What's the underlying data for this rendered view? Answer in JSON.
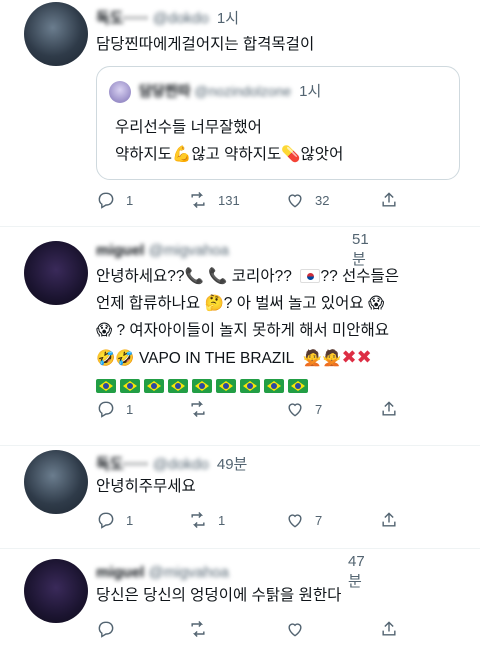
{
  "tweets": [
    {
      "display_name": "독도·····",
      "handle": "@dokdo",
      "time": "1시",
      "text": "담당찐따에게걸어지는 합격목걸이",
      "quote": {
        "display_name": "담당찐따",
        "handle": "@nozindolzone",
        "time": "1시",
        "line1": "우리선수들 너무잘했어",
        "line2_a": "약하지도",
        "line2_b": "않고 약하지도",
        "line2_c": "않앗어",
        "emoji_muscle": "💪",
        "emoji_pill": "💊"
      },
      "replies": "1",
      "retweets": "131",
      "likes": "32"
    },
    {
      "display_name": "miguel",
      "handle": "@migvahoa",
      "time": "51분",
      "lines": [
        "안녕하세요??",
        "코리아??",
        "?? 선수들은",
        "언제 합류하나요",
        "? 아 벌써 놀고 있어요",
        "? 여자아이들이 놀지 못하게 해서 미안해요",
        "VAPO IN THE BRAZIL"
      ],
      "replies": "1",
      "retweets": "",
      "likes": "7"
    },
    {
      "display_name": "독도·····",
      "handle": "@dokdo",
      "time": "49분",
      "text": "안녕히주무세요",
      "replies": "1",
      "retweets": "1",
      "likes": "7"
    },
    {
      "display_name": "miguel",
      "handle": "@migvahoa",
      "time": "47분",
      "text": "당신은 당신의 엉덩이에 수탉을 원한다",
      "replies": "",
      "retweets": "",
      "likes": ""
    }
  ],
  "icons": {
    "reply": "reply-icon",
    "retweet": "retweet-icon",
    "like": "heart-icon",
    "share": "share-icon"
  },
  "colors": {
    "text": "#0f1419",
    "muted": "#536471",
    "border": "#cfd9de",
    "flag_br": "#229e45",
    "x_red": "#dd2e44"
  }
}
